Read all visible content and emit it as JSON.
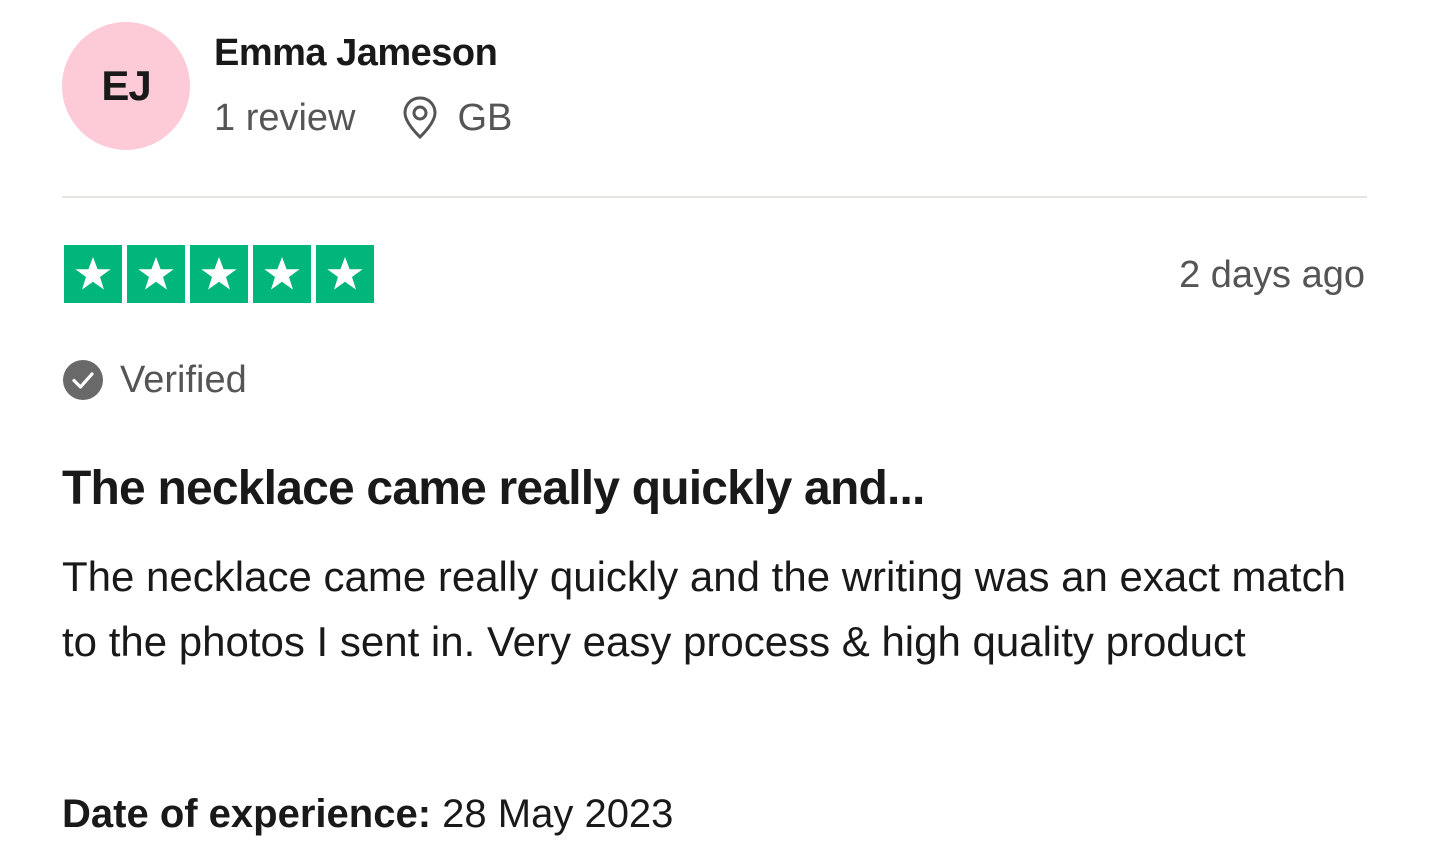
{
  "reviewer": {
    "initials": "EJ",
    "name": "Emma Jameson",
    "review_count": "1 review",
    "location": "GB",
    "avatar_color": "#fccbd7"
  },
  "review": {
    "rating": 5,
    "rating_max": 5,
    "star_color": "#00b67a",
    "posted": "2 days ago",
    "verified_label": "Verified",
    "title": "The necklace came really quickly and...",
    "body": "The necklace came really quickly and the writing was an exact match to the photos I sent in. Very easy process & high quality product",
    "experience_label": "Date of experience:",
    "experience_date": "28 May 2023"
  },
  "icons": {
    "location": "location-pin-icon",
    "verified": "verified-check-icon",
    "star": "star-icon"
  }
}
